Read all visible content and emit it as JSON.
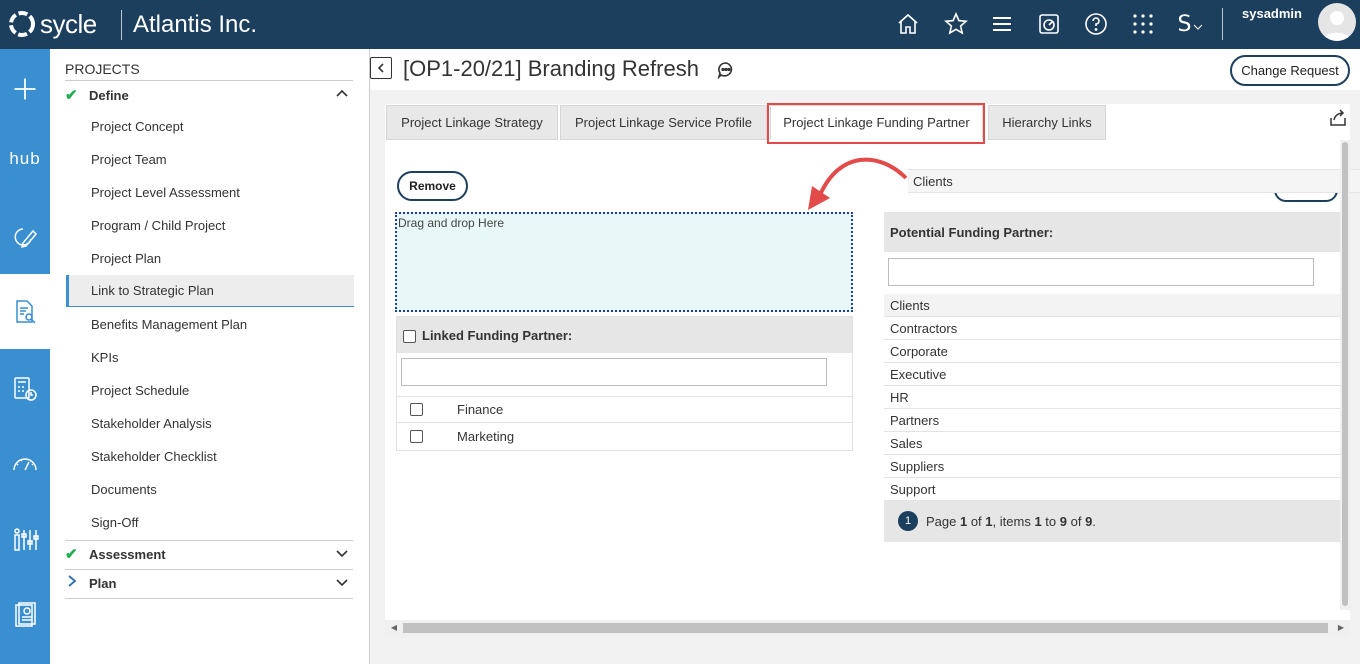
{
  "header": {
    "logo_text": "sycle",
    "company": "Atlantis Inc.",
    "username": "sysadmin",
    "icons": [
      "home-icon",
      "star-icon",
      "menu-icon",
      "dashboard-icon",
      "help-icon",
      "apps-grid-icon",
      "s-dropdown-icon"
    ],
    "s_label": "S"
  },
  "rail": {
    "items": [
      "add-icon",
      "hub",
      "edit-refresh-icon",
      "document-search-icon",
      "calculator-clock-icon",
      "gauge-icon",
      "sliders-people-icon",
      "report-icon"
    ],
    "hub_label": "hub"
  },
  "sidebar": {
    "title": "PROJECTS",
    "sections": [
      {
        "label": "Define",
        "expanded": true
      },
      {
        "label": "Assessment",
        "expanded": false
      },
      {
        "label": "Plan",
        "expanded": false
      }
    ],
    "items": [
      "Project Concept",
      "Project Team",
      "Project Level Assessment",
      "Program / Child Project",
      "Project Plan",
      "Link to Strategic Plan",
      "Benefits Management Plan",
      "KPIs",
      "Project Schedule",
      "Stakeholder Analysis",
      "Stakeholder Checklist",
      "Documents",
      "Sign-Off"
    ],
    "active_item": "Link to Strategic Plan"
  },
  "page": {
    "title": "[OP1-20/21] Branding Refresh",
    "change_request": "Change Request"
  },
  "tabs": [
    "Project Linkage Strategy",
    "Project Linkage Service Profile",
    "Project Linkage Funding Partner",
    "Hierarchy Links"
  ],
  "active_tab": "Project Linkage Funding Partner",
  "left_panel": {
    "remove_label": "Remove",
    "drop_text": "Drag and drop Here",
    "grid_title": "Linked Funding Partner:",
    "rows": [
      "Finance",
      "Marketing"
    ]
  },
  "drag_ghost": "Clients",
  "right_panel": {
    "grid_title": "Potential Funding Partner:",
    "rows": [
      "Clients",
      "Contractors",
      "Corporate",
      "Executive",
      "HR",
      "Partners",
      "Sales",
      "Suppliers",
      "Support"
    ],
    "pager": {
      "current_page": "1",
      "prefix": "Page ",
      "page": "1",
      "of_label": " of ",
      "total_pages": "1",
      "items_label": ", items ",
      "from": "1",
      "to_label": " to ",
      "to": "9",
      "of2_label": " of ",
      "total": "9",
      "suffix": "."
    }
  },
  "colors": {
    "header_bg": "#1d3f5e",
    "rail_bg": "#3a8fd0",
    "highlight_red": "#e34a4a",
    "check_green": "#1fae4f",
    "drop_bg": "#e8f7f7"
  }
}
